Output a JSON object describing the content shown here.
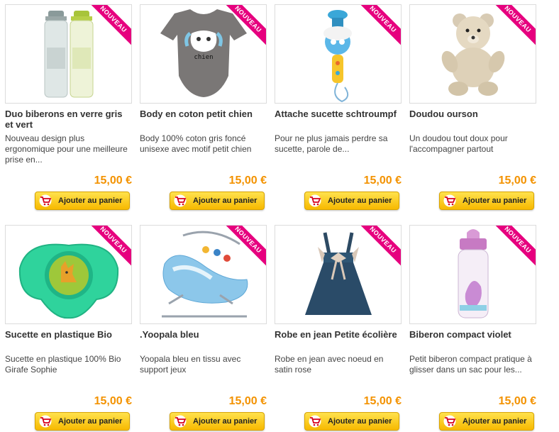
{
  "badge_text": "NOUVEAU",
  "colors": {
    "badge": "#e6007e",
    "price": "#f39200",
    "button": "#f7b900",
    "cart_icon": "#d6001c"
  },
  "cart_icon": "shopping-cart-icon",
  "products": [
    {
      "image": "baby-bottles-image",
      "title": "Duo biberons en verre gris et vert",
      "description": "Nouveau design plus ergonomique pour une meilleure prise en...",
      "price": "15,00 €",
      "button": "Ajouter au panier"
    },
    {
      "image": "baby-bodysuit-image",
      "title": "Body en coton petit chien",
      "description": "Body 100% coton gris foncé unisexe avec motif petit chien",
      "price": "15,00 €",
      "button": "Ajouter au panier"
    },
    {
      "image": "pacifier-clip-image",
      "title": "Attache sucette schtroumpf",
      "description": "Pour ne plus jamais perdre sa sucette, parole de...",
      "price": "15,00 €",
      "button": "Ajouter au panier"
    },
    {
      "image": "teddy-bear-image",
      "title": "Doudou ourson",
      "description": "Un doudou tout doux pour l'accompagner partout",
      "price": "15,00 €",
      "button": "Ajouter au panier"
    },
    {
      "image": "pacifier-image",
      "title": "Sucette en plastique Bio",
      "description": "Sucette en plastique 100% Bio Girafe Sophie",
      "price": "15,00 €",
      "button": "Ajouter au panier"
    },
    {
      "image": "baby-bouncer-image",
      "title": ".Yoopala bleu",
      "description": "Yoopala bleu en tissu avec support jeux",
      "price": "15,00 €",
      "button": "Ajouter au panier"
    },
    {
      "image": "denim-dress-image",
      "title": "Robe en jean Petite écolière",
      "description": "Robe en jean avec noeud en satin rose",
      "price": "15,00 €",
      "button": "Ajouter au panier"
    },
    {
      "image": "pink-bottle-image",
      "title": "Biberon compact violet",
      "description": "Petit biberon compact pratique à glisser dans un sac pour les...",
      "price": "15,00 €",
      "button": "Ajouter au panier"
    }
  ],
  "bodysuit_print": "chien"
}
